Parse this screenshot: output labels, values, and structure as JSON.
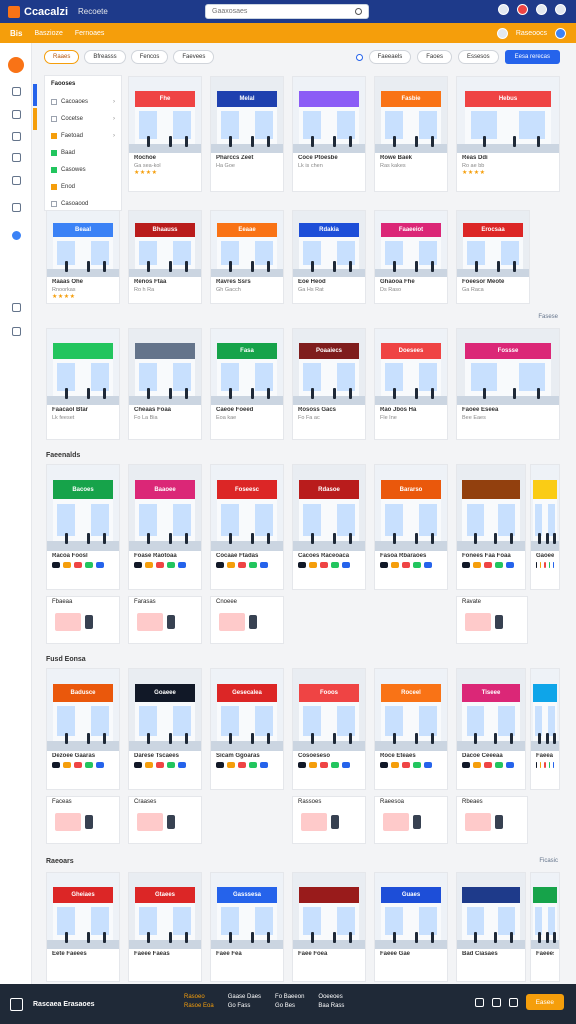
{
  "header": {
    "brand": "Ccacalzi",
    "link": "Recoete",
    "search_placeholder": "Gaaxosaes"
  },
  "subbar": {
    "brand": "Bis",
    "crumbs": [
      "Baszioze",
      "Fernoaes"
    ],
    "right_label": "Raseoocs"
  },
  "filters": {
    "pills": [
      "Raaes",
      "Bfreasss",
      "Fencos",
      "Faevees"
    ],
    "right": [
      "Faeeaels",
      "Faoes",
      "Essesos"
    ],
    "primary": "Eesa rerecas"
  },
  "panel": {
    "title": "Faooses",
    "rows": [
      "Cacoaoes",
      "Cocetse",
      "Faetoad",
      "Baad",
      "Casowes",
      "Enod",
      "Casoaood"
    ]
  },
  "sections": {
    "s1": "Faeenalds",
    "s2": "Fusd Eonsa",
    "s3": "Raeoars",
    "see_more": "Fasese",
    "see_more_2": "Ficasic"
  },
  "cards": {
    "r1": [
      {
        "title": "Rochoe",
        "sub": "Ga sea-kol",
        "brand": "Fhe",
        "rating": "★★★★",
        "color": "#ef4444"
      },
      {
        "title": "Pharccs Zeet",
        "sub": "Ha Goe",
        "brand": "Melal",
        "color": "#1e40af"
      },
      {
        "title": "Coce Ptoesbe",
        "sub": "Lk is chen",
        "brand": "",
        "color": "#8b5cf6"
      },
      {
        "title": "Rowe Baek",
        "sub": "Ras kakes",
        "brand": "Fasbie",
        "color": "#f97316"
      },
      {
        "title": "Reas Ddi",
        "sub": "Ro ae bb",
        "brand": "Hebus",
        "rating": "★★★★",
        "color": "#ef4444"
      }
    ],
    "r2": [
      {
        "title": "Raaas Ohe",
        "sub": "Rnoorkas",
        "brand": "Beaal",
        "rating": "★★★★",
        "color": "#3b82f6"
      },
      {
        "title": "Renos Ftaa",
        "sub": "Ro h Ra",
        "brand": "Bhaauss",
        "color": "#b91c1c"
      },
      {
        "title": "Ravres Ssrs",
        "sub": "Gh Gacch",
        "brand": "Eeaae",
        "color": "#f97316"
      },
      {
        "title": "Eoe Heod",
        "sub": "Ga Hs Rat",
        "brand": "Rdakia",
        "color": "#1d4ed8"
      },
      {
        "title": "Ghaooa Fhe",
        "sub": "Ds Raso",
        "brand": "Faaeeiot",
        "color": "#db2777"
      },
      {
        "title": "Foeesor Meote",
        "sub": "Ga Raca",
        "brand": "Erocsaa",
        "color": "#dc2626"
      }
    ],
    "r3": [
      {
        "title": "Faacaol Btar",
        "sub": "Lk feeset",
        "brand": "",
        "color": "#22c55e"
      },
      {
        "title": "Cheaas Foaa",
        "sub": "Fo La Bia",
        "brand": "",
        "color": "#64748b"
      },
      {
        "title": "Caeoe Foeed",
        "sub": "Eoa kae",
        "brand": "Fasa",
        "color": "#16a34a"
      },
      {
        "title": "Rososs Gacs",
        "sub": "Fo Fa ac",
        "brand": "Poaaiecs",
        "color": "#7f1d1d"
      },
      {
        "title": "Rao Jbos Ha",
        "sub": "Fle Ine",
        "brand": "Doesees",
        "color": "#ef4444"
      },
      {
        "title": "Faoee Eseea",
        "sub": "Bee Eaes",
        "brand": "Fossse",
        "color": "#db2777"
      }
    ],
    "r4": [
      {
        "title": "Racoa Foosl",
        "sub": "",
        "brand": "Bacoes",
        "color": "#16a34a"
      },
      {
        "title": "Foase Raotoaa",
        "sub": "",
        "brand": "Baaoee",
        "color": "#db2777"
      },
      {
        "title": "Cocaae Ftadas",
        "sub": "",
        "brand": "Foseesc",
        "color": "#dc2626"
      },
      {
        "title": "Cacoes Raceoaca",
        "sub": "",
        "brand": "Rdasoe",
        "color": "#b91c1c"
      },
      {
        "title": "Fasoa Rbaraoes",
        "sub": "",
        "brand": "Bararso",
        "color": "#ea580c"
      },
      {
        "title": "Fonees Faa Foaa",
        "sub": "",
        "brand": "",
        "color": "#92400e"
      },
      {
        "title": "Gaoeee",
        "sub": "",
        "brand": "",
        "color": "#facc15"
      }
    ],
    "r4b": [
      "Fbaeaa",
      "Farasas",
      "Cnoeee",
      "Ravate"
    ],
    "r5": [
      {
        "title": "Dezoee Gaaras",
        "sub": "",
        "brand": "Badusce",
        "color": "#ea580c"
      },
      {
        "title": "Darese Tscaees",
        "sub": "",
        "brand": "Goaeee",
        "color": "#111827"
      },
      {
        "title": "Sicam Ggoaras",
        "sub": "",
        "brand": "Gesecalea",
        "color": "#dc2626"
      },
      {
        "title": "Cosoeseso",
        "sub": "",
        "brand": "Fooos",
        "color": "#ef4444"
      },
      {
        "title": "Roce Eteaes",
        "sub": "",
        "brand": "Roceel",
        "color": "#f97316"
      },
      {
        "title": "Dacoe Ceeeaa",
        "sub": "",
        "brand": "Tiseee",
        "color": "#db2777"
      },
      {
        "title": "Faeea",
        "sub": "",
        "brand": "",
        "color": "#0ea5e9"
      }
    ],
    "r5b": [
      "Faceas",
      "Craases",
      "Rassoes",
      "Raeesoa",
      "Rbeaes"
    ],
    "r6": [
      {
        "title": "Eete Faeees",
        "sub": "",
        "brand": "Gheiaes",
        "color": "#dc2626"
      },
      {
        "title": "Faeee Faeas",
        "sub": "",
        "brand": "Gtaees",
        "color": "#dc2626"
      },
      {
        "title": "Faee Fea",
        "sub": "",
        "brand": "Gasssesa",
        "color": "#2563eb"
      },
      {
        "title": "Faee Foea",
        "sub": "",
        "brand": "",
        "color": "#991b1b"
      },
      {
        "title": "Faeee Gae",
        "sub": "",
        "brand": "Guaes",
        "color": "#1d4ed8"
      },
      {
        "title": "Bad Ciasaes",
        "sub": "",
        "brand": "",
        "color": "#1e3a8a"
      },
      {
        "title": "Faeees",
        "sub": "",
        "brand": "",
        "color": "#16a34a"
      }
    ]
  },
  "footer": {
    "name": "Rascaea Erasaoes",
    "links": [
      "Rasoeo",
      "Gaase Daes",
      "Fo Baeeon",
      "Ooeeoes",
      "Rasoe Eoa",
      "Go Fass",
      "Go Bes",
      "Baa Rass"
    ],
    "cta": "Easee"
  }
}
